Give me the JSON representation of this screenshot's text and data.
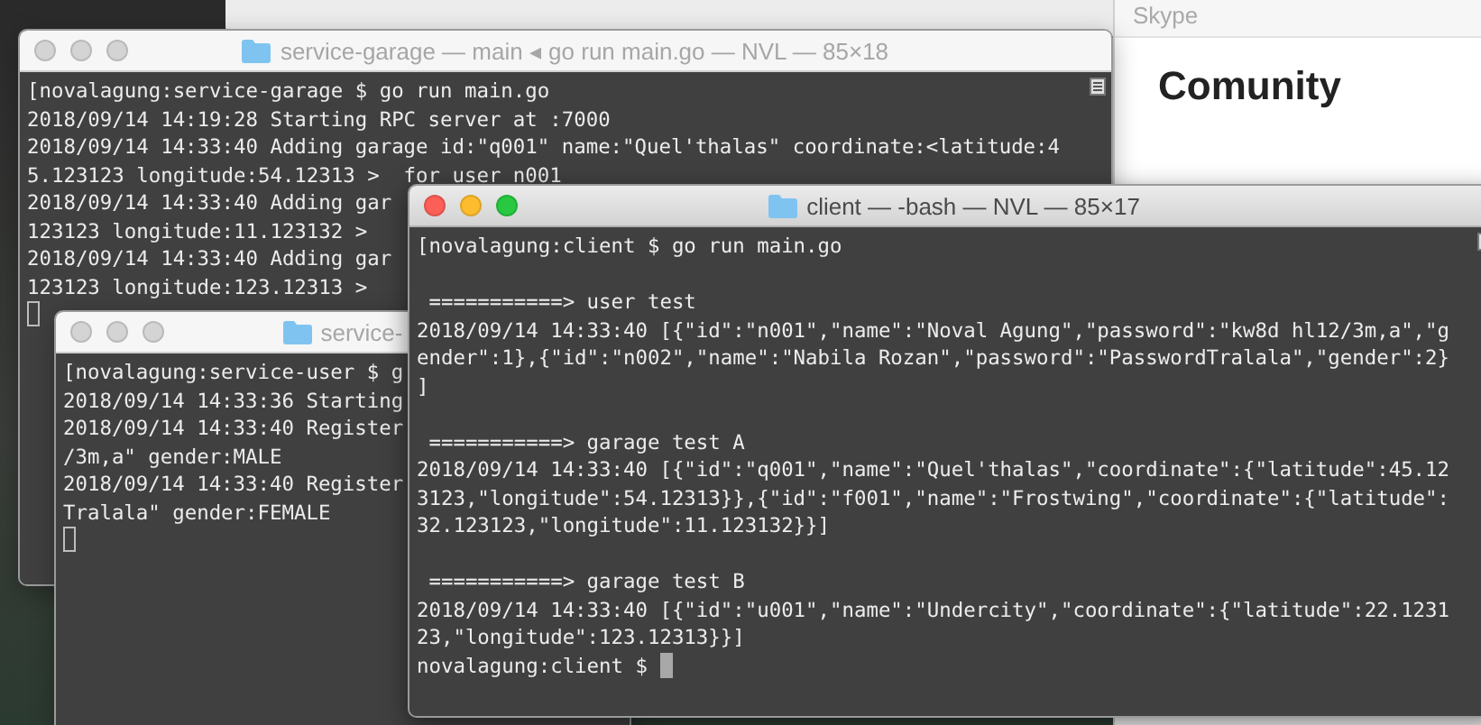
{
  "windows": [
    {
      "kind": "browser",
      "title": "Skype",
      "heading": "Comunity"
    },
    {
      "kind": "terminal",
      "title": "service-garage — main ◂ go run main.go — NVL — 85×18",
      "focused": false,
      "sections": [
        [
          "[novalagung:service-garage $ go run main.go",
          "2018/09/14 14:19:28 Starting RPC server at :7000",
          "2018/09/14 14:33:40 Adding garage id:\"q001\" name:\"Quel'thalas\" coordinate:<latitude:4",
          "5.123123 longitude:54.12313 >  for user n001",
          "2018/09/14 14:33:40 Adding gar",
          "123123 longitude:11.123132 >",
          "2018/09/14 14:33:40 Adding gar",
          "123123 longitude:123.12313 >"
        ]
      ]
    },
    {
      "kind": "terminal",
      "title": "service-",
      "focused": false,
      "sections": [
        [
          "[novalagung:service-user $ g",
          "2018/09/14 14:33:36 Starting",
          "2018/09/14 14:33:40 Register",
          "/3m,a\" gender:MALE",
          "2018/09/14 14:33:40 Register",
          "Tralala\" gender:FEMALE"
        ]
      ]
    },
    {
      "kind": "terminal",
      "title": "client — -bash — NVL — 85×17",
      "focused": true,
      "prompt": "novalagung:client $",
      "sections": [
        [
          "[novalagung:client $ go run main.go"
        ],
        [
          " ===========> user test",
          "2018/09/14 14:33:40 [{\"id\":\"n001\",\"name\":\"Noval Agung\",\"password\":\"kw8d hl12/3m,a\",\"g",
          "ender\":1},{\"id\":\"n002\",\"name\":\"Nabila Rozan\",\"password\":\"PasswordTralala\",\"gender\":2}",
          "]"
        ],
        [
          " ===========> garage test A",
          "2018/09/14 14:33:40 [{\"id\":\"q001\",\"name\":\"Quel'thalas\",\"coordinate\":{\"latitude\":45.12",
          "3123,\"longitude\":54.12313}},{\"id\":\"f001\",\"name\":\"Frostwing\",\"coordinate\":{\"latitude\":",
          "32.123123,\"longitude\":11.123132}}]"
        ],
        [
          " ===========> garage test B",
          "2018/09/14 14:33:40 [{\"id\":\"u001\",\"name\":\"Undercity\",\"coordinate\":{\"latitude\":22.1231",
          "23,\"longitude\":123.12313}}]"
        ]
      ]
    }
  ]
}
